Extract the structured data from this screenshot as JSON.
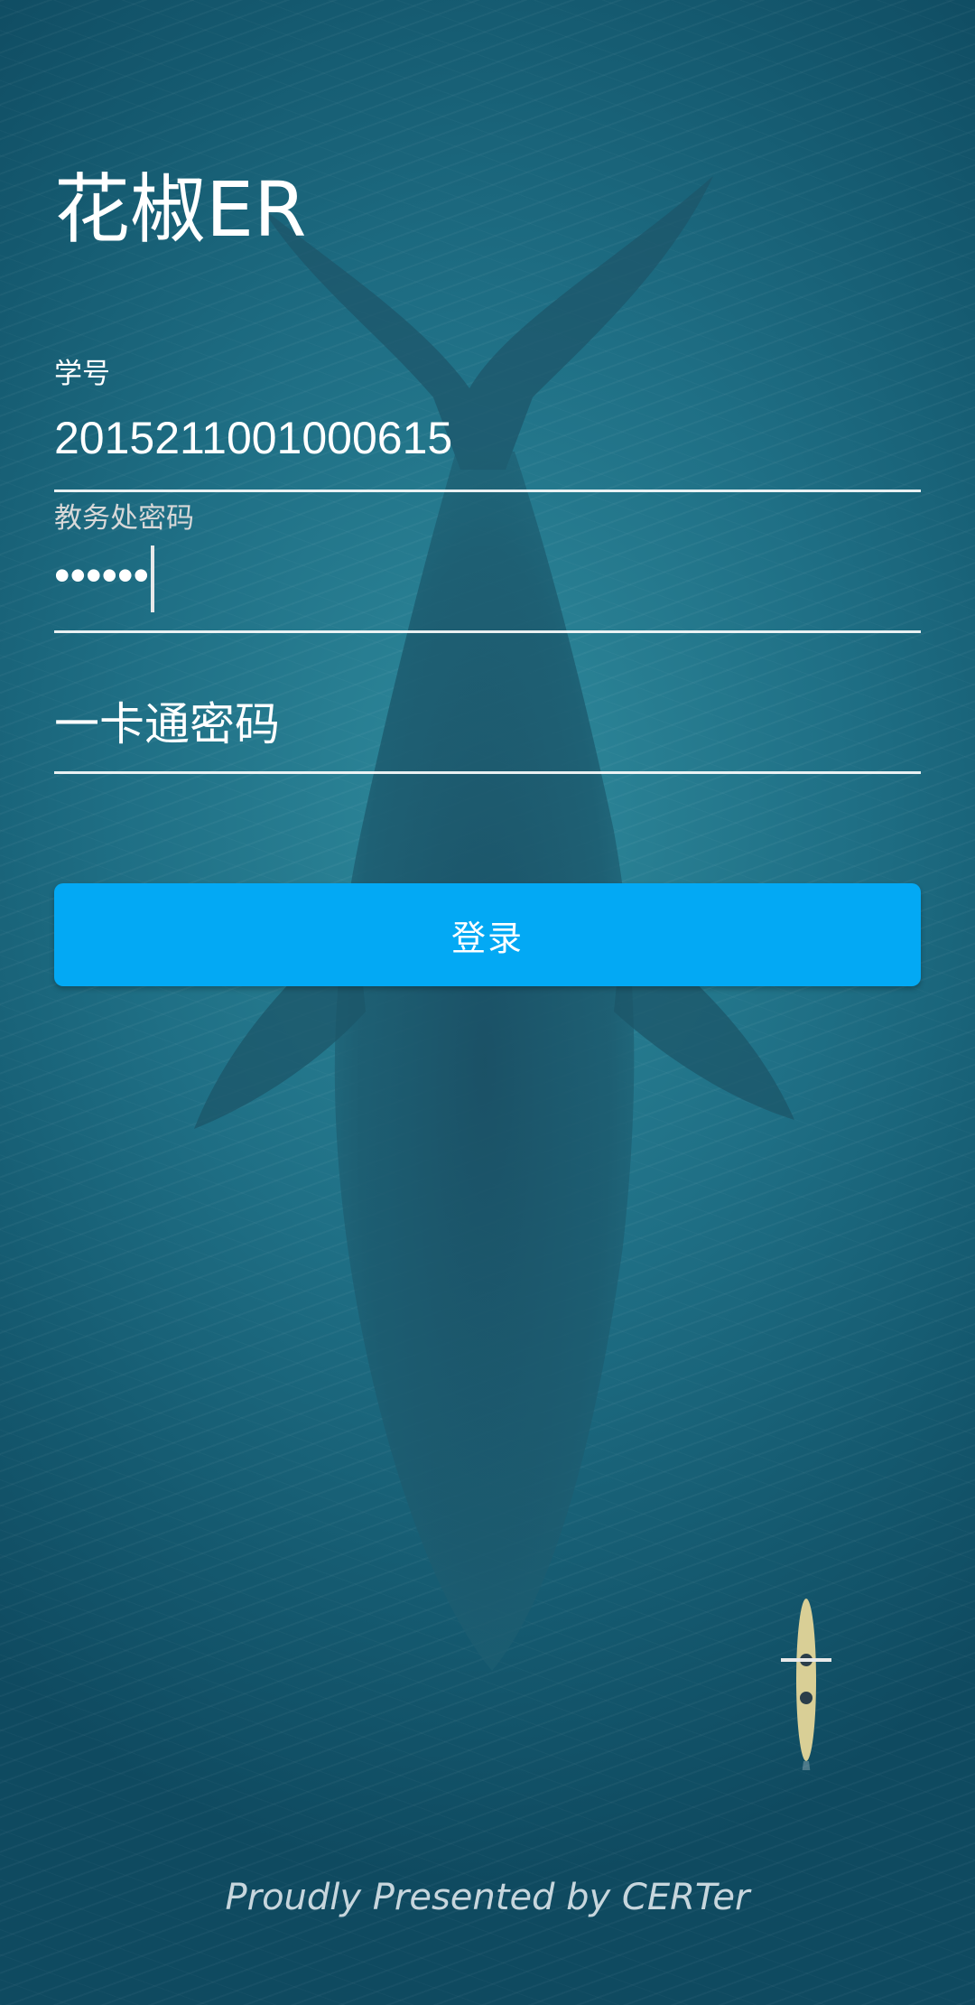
{
  "app": {
    "title": "花椒ER"
  },
  "form": {
    "student_id": {
      "label": "学号",
      "value": "2015211001000615"
    },
    "academic_password": {
      "label": "教务处密码",
      "value_masked": "••••••"
    },
    "card_password": {
      "placeholder": "一卡通密码"
    },
    "login_button": {
      "label": "登录"
    }
  },
  "footer": {
    "text": "Proudly Presented by CERTer"
  },
  "colors": {
    "accent": "#03a9f4",
    "text": "#ffffff",
    "underline": "#ffffff",
    "background_sea": "#1f6f85"
  },
  "icons": {
    "background": "whale-ocean-image",
    "kayak": "kayak-image"
  }
}
